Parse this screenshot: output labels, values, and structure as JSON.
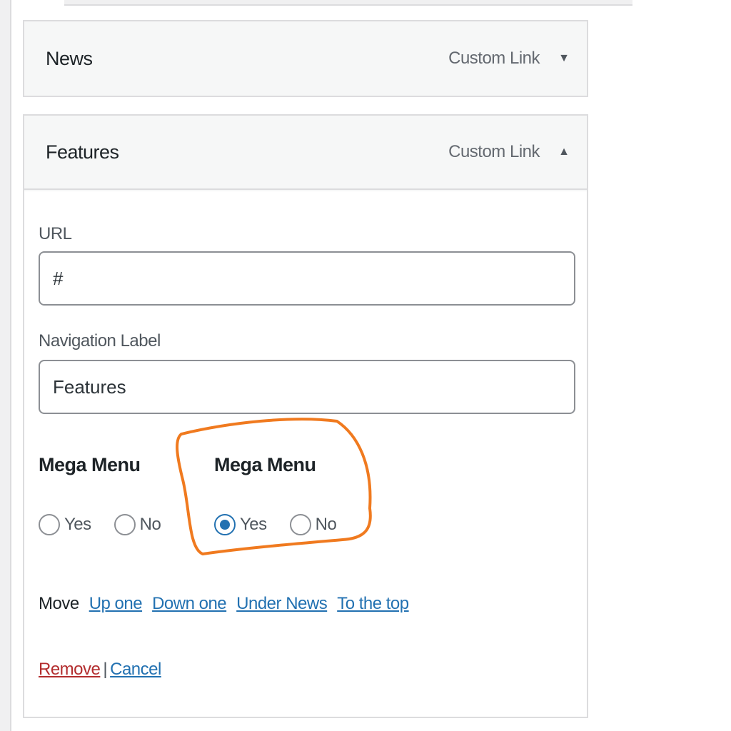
{
  "menu_items": [
    {
      "title": "News",
      "type": "Custom Link",
      "expanded": false
    },
    {
      "title": "Features",
      "type": "Custom Link",
      "expanded": true
    }
  ],
  "features_settings": {
    "url_label": "URL",
    "url_value": "#",
    "nav_label": "Navigation Label",
    "nav_value": "Features",
    "mega_menu_1": {
      "heading": "Mega Menu",
      "yes": "Yes",
      "no": "No",
      "selected": "none"
    },
    "mega_menu_2": {
      "heading": "Mega Menu",
      "yes": "Yes",
      "no": "No",
      "selected": "Yes"
    },
    "move_label": "Move",
    "move_links": [
      "Up one",
      "Down one",
      "Under News",
      "To the top"
    ],
    "remove_label": "Remove",
    "separator": "|",
    "cancel_label": "Cancel"
  },
  "colors": {
    "link": "#2271b1",
    "remove": "#b32d2e",
    "annotation": "#f07a1f",
    "radio_selected": "#2271b1"
  }
}
